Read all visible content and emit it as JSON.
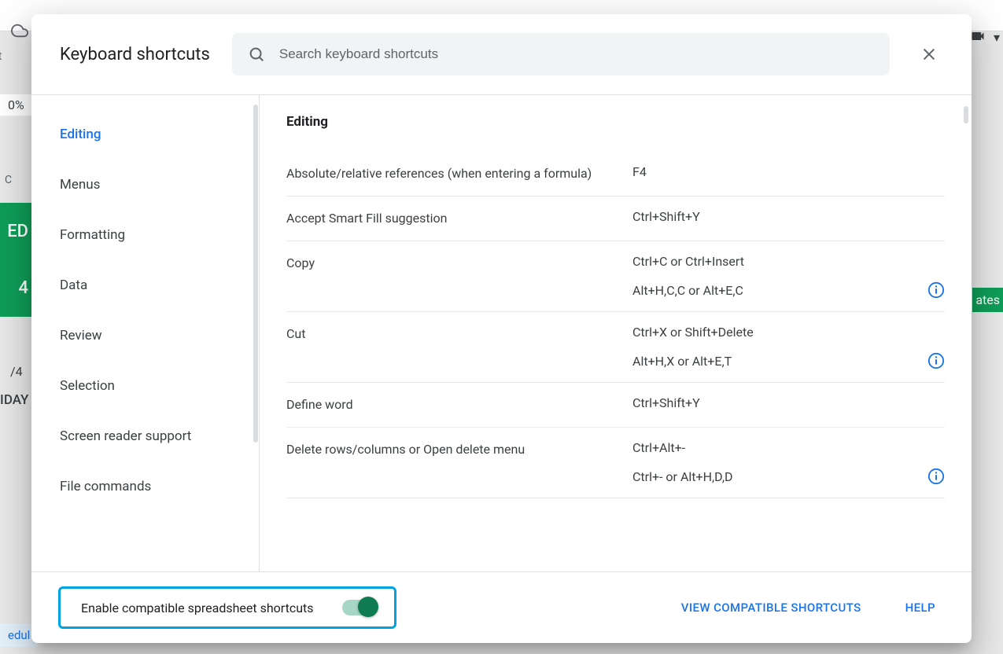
{
  "bg": {
    "rt": "rt",
    "percent": "0%",
    "c": "C",
    "ed": "ED",
    "four": "4",
    "frac": "/4",
    "day": "IDAY",
    "edul": "edul",
    "ates": "ates"
  },
  "dialog": {
    "title": "Keyboard shortcuts",
    "search_placeholder": "Search keyboard shortcuts"
  },
  "sidebar": {
    "items": [
      {
        "label": "Editing",
        "active": true
      },
      {
        "label": "Menus"
      },
      {
        "label": "Formatting"
      },
      {
        "label": "Data"
      },
      {
        "label": "Review"
      },
      {
        "label": "Selection"
      },
      {
        "label": "Screen reader support"
      },
      {
        "label": "File commands"
      }
    ]
  },
  "content": {
    "section": "Editing",
    "rows": [
      {
        "name": "Absolute/relative references (when entering a formula)",
        "keys": [
          "F4"
        ]
      },
      {
        "name": "Accept Smart Fill suggestion",
        "keys": [
          "Ctrl+Shift+Y"
        ]
      },
      {
        "name": "Copy",
        "keys": [
          "Ctrl+C or Ctrl+Insert",
          "Alt+H,C,C or Alt+E,C"
        ],
        "info_on": 1
      },
      {
        "name": "Cut",
        "keys": [
          "Ctrl+X or Shift+Delete",
          "Alt+H,X or Alt+E,T"
        ],
        "info_on": 1
      },
      {
        "name": "Define word",
        "keys": [
          "Ctrl+Shift+Y"
        ]
      },
      {
        "name": "Delete rows/columns or Open delete menu",
        "keys": [
          "Ctrl+Alt+-",
          "Ctrl+- or Alt+H,D,D"
        ],
        "info_on": 1
      }
    ]
  },
  "footer": {
    "toggle_label": "Enable compatible spreadsheet shortcuts",
    "view_link": "VIEW COMPATIBLE SHORTCUTS",
    "help_link": "HELP"
  }
}
